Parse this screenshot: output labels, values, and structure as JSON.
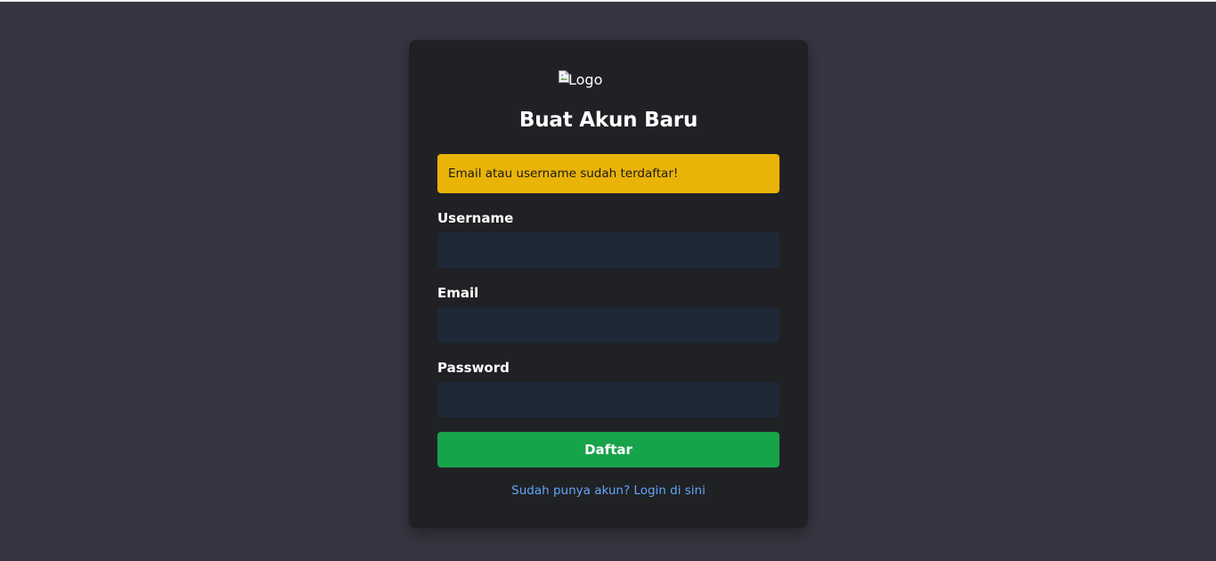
{
  "colors": {
    "page_background": "#363541",
    "card_background": "#202124",
    "alert_background": "#e9b308",
    "input_background": "#1e2837",
    "submit_background": "#17a34a",
    "link_color": "#60a5fa"
  },
  "logo": {
    "alt": "Logo",
    "icon": "broken-image-icon"
  },
  "title": "Buat Akun Baru",
  "alert": {
    "message": "Email atau username sudah terdaftar!"
  },
  "form": {
    "username": {
      "label": "Username",
      "value": ""
    },
    "email": {
      "label": "Email",
      "value": ""
    },
    "password": {
      "label": "Password",
      "value": ""
    },
    "submit_label": "Daftar"
  },
  "login_link": "Sudah punya akun? Login di sini"
}
